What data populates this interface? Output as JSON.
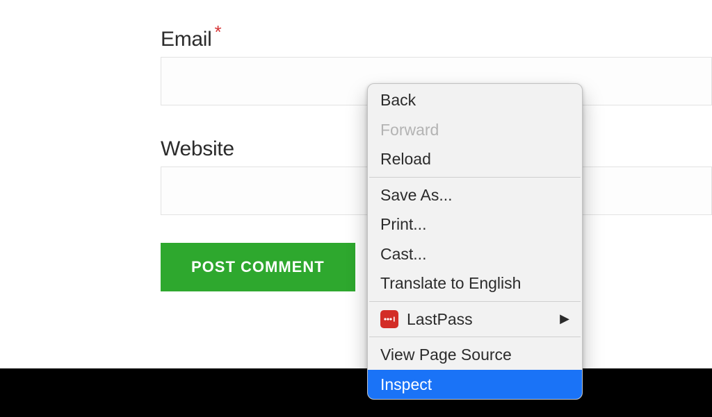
{
  "form": {
    "email_label": "Email",
    "required_mark": "*",
    "website_label": "Website",
    "submit_label": "POST COMMENT"
  },
  "context_menu": {
    "back": "Back",
    "forward": "Forward",
    "reload": "Reload",
    "save_as": "Save As...",
    "print": "Print...",
    "cast": "Cast...",
    "translate": "Translate to English",
    "lastpass": "LastPass",
    "view_source": "View Page Source",
    "inspect": "Inspect"
  }
}
